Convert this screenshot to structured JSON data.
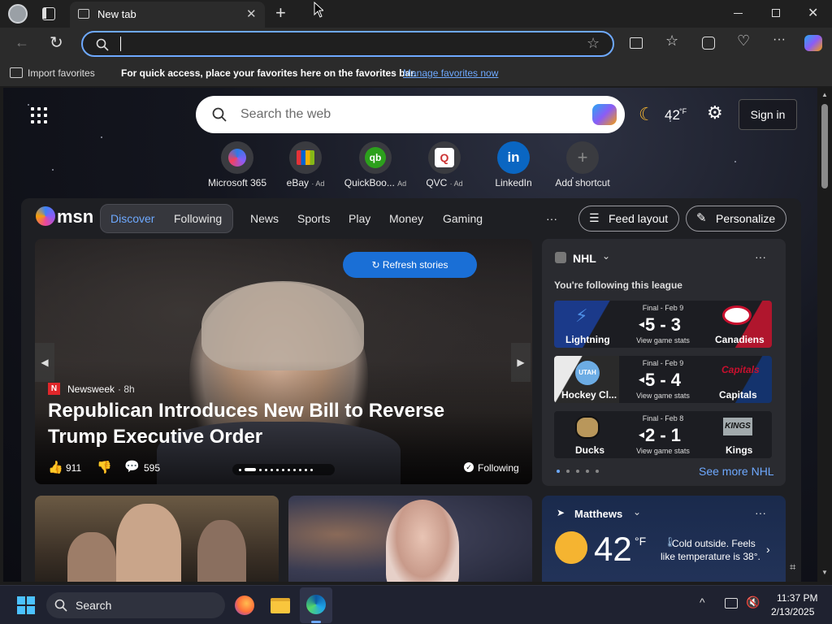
{
  "browser": {
    "tab_title": "New tab",
    "address_value": "",
    "favorites_import": "Import favorites",
    "favorites_message": "For quick access, place your favorites here on the favorites bar.",
    "favorites_link": "Manage favorites now"
  },
  "newtab": {
    "search_placeholder": "Search the web",
    "weather_temp": "42",
    "weather_unit": "°F",
    "sign_in": "Sign in",
    "shortcuts": [
      {
        "label": "Microsoft 365",
        "ad": ""
      },
      {
        "label": "eBay",
        "ad": "· Ad"
      },
      {
        "label": "QuickBoo...",
        "ad": "Ad"
      },
      {
        "label": "QVC",
        "ad": "· Ad"
      },
      {
        "label": "LinkedIn",
        "ad": ""
      },
      {
        "label": "Add shortcut",
        "ad": ""
      }
    ]
  },
  "feed_nav": {
    "brand": "msn",
    "discover": "Discover",
    "following": "Following",
    "items": [
      "News",
      "Sports",
      "Play",
      "Money",
      "Gaming"
    ],
    "more": "···",
    "feed_layout": "Feed layout",
    "personalize": "Personalize"
  },
  "hero": {
    "refresh": "Refresh stories",
    "source": "Newsweek",
    "source_time": "· 8h",
    "headline": "Republican Introduces New Bill to Reverse Trump Executive Order",
    "likes": "911",
    "comments": "595",
    "following": "Following",
    "source_letter": "N"
  },
  "nhl": {
    "title": "NHL",
    "subtitle": "You're following this league",
    "see_more": "See more NHL",
    "games": [
      {
        "status": "Final - Feb 9",
        "home": "Lightning",
        "away": "Canadiens",
        "score": "5 - 3",
        "stats": "View game stats",
        "home_color": "#1b3a8a",
        "away_color": "#b0162d"
      },
      {
        "status": "Final - Feb 9",
        "home": "Hockey Cl...",
        "away": "Capitals",
        "score": "5 - 4",
        "stats": "View game stats",
        "home_color": "#eaeaea",
        "away_color": "#14336d"
      },
      {
        "status": "Final - Feb 8",
        "home": "Ducks",
        "away": "Kings",
        "score": "2 - 1",
        "stats": "View game stats",
        "home_color": "#2a2a2a",
        "away_color": "#2f2f2f"
      }
    ]
  },
  "weather": {
    "location": "Matthews",
    "temp": "42",
    "unit": "°F",
    "note": "Cold outside. Feels like temperature is 38°."
  },
  "taskbar": {
    "search": "Search",
    "time": "11:37 PM",
    "date": "2/13/2025"
  }
}
